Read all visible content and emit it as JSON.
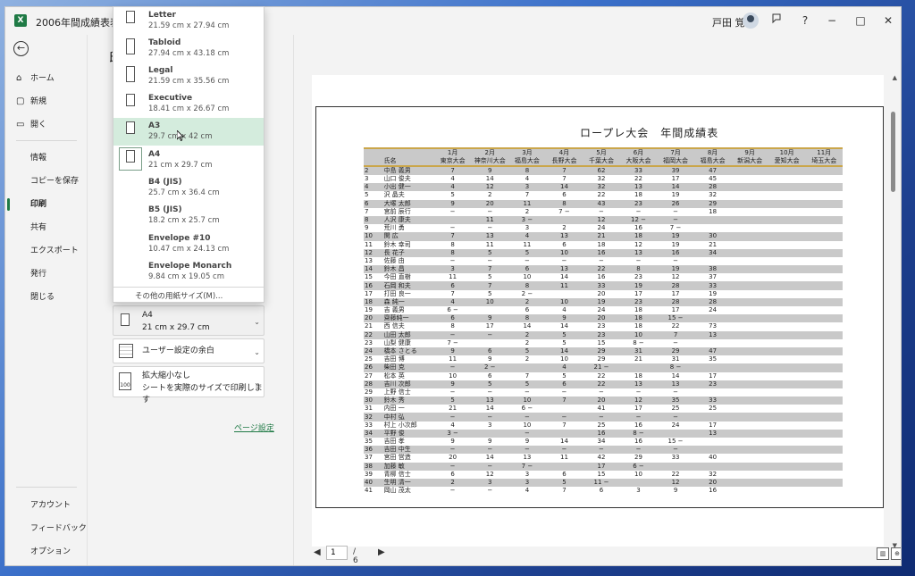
{
  "window": {
    "title": "2006年間成績表表示設定",
    "user_name": "戸田 覚",
    "app_icon": "X"
  },
  "titlebar_buttons": {
    "feedback_icon": "feedback-icon",
    "help": "?",
    "minimize": "−",
    "maximize": "□",
    "close": "✕"
  },
  "sidebar": {
    "back_icon": "←",
    "items": [
      {
        "label": "ホーム",
        "icon": "⌂"
      },
      {
        "label": "新規",
        "icon": "▢"
      },
      {
        "label": "開く",
        "icon": "▭"
      },
      {
        "label": "情報"
      },
      {
        "label": "コピーを保存"
      },
      {
        "label": "印刷"
      },
      {
        "label": "共有"
      },
      {
        "label": "エクスポート"
      },
      {
        "label": "発行"
      },
      {
        "label": "閉じる"
      },
      {
        "label": "アカウント"
      },
      {
        "label": "フィードバック"
      },
      {
        "label": "オプション"
      }
    ]
  },
  "panel": {
    "heading_initial": "印",
    "paper_size_value": "A4",
    "paper_size_dims": "21 cm x 29.7 cm",
    "margins_label": "ユーザー設定の余白",
    "scaling_line1": "拡大縮小なし",
    "scaling_line2": "シートを実際のサイズで印刷します",
    "page_setup_link": "ページ設定"
  },
  "paper_dropdown": {
    "items": [
      {
        "name": "Letter",
        "dims": "21.59 cm x 27.94 cm"
      },
      {
        "name": "Tabloid",
        "dims": "27.94 cm x 43.18 cm"
      },
      {
        "name": "Legal",
        "dims": "21.59 cm x 35.56 cm"
      },
      {
        "name": "Executive",
        "dims": "18.41 cm x 26.67 cm"
      },
      {
        "name": "A3",
        "dims": "29.7 cm x 42 cm"
      },
      {
        "name": "A4",
        "dims": "21 cm x 29.7 cm"
      },
      {
        "name": "B4 (JIS)",
        "dims": "25.7 cm x 36.4 cm"
      },
      {
        "name": "B5 (JIS)",
        "dims": "18.2 cm x 25.7 cm"
      },
      {
        "name": "Envelope #10",
        "dims": "10.47 cm x 24.13 cm"
      },
      {
        "name": "Envelope Monarch",
        "dims": "9.84 cm x 19.05 cm"
      }
    ],
    "more_label": "その他の用紙サイズ(M)..."
  },
  "preview": {
    "sheet_title": "ロープレ大会　年間成績表",
    "header_months": [
      "",
      "",
      "1月",
      "2月",
      "3月",
      "4月",
      "5月",
      "6月",
      "7月",
      "8月",
      "9月",
      "10月",
      "11月"
    ],
    "header_venues": [
      "",
      "氏名",
      "東京大会",
      "神奈川大会",
      "福島大会",
      "長野大会",
      "千葉大会",
      "大阪大会",
      "福岡大会",
      "福島大会",
      "新潟大会",
      "愛知大会",
      "埼玉大会"
    ],
    "rows": [
      [
        "2",
        "中島 義男",
        "7",
        "9",
        "8",
        "7",
        "62",
        "33",
        "39",
        "47",
        "",
        "",
        ""
      ],
      [
        "3",
        "山口 俊夫",
        "4",
        "14",
        "4",
        "7",
        "32",
        "22",
        "17",
        "45",
        "",
        "",
        ""
      ],
      [
        "4",
        "小出 健一",
        "4",
        "12",
        "3",
        "14",
        "32",
        "13",
        "14",
        "28",
        "",
        "",
        ""
      ],
      [
        "5",
        "沢 晶夫",
        "5",
        "2",
        "7",
        "6",
        "22",
        "18",
        "19",
        "32",
        "",
        "",
        ""
      ],
      [
        "6",
        "大塚 太郎",
        "9",
        "20",
        "11",
        "8",
        "43",
        "23",
        "26",
        "29",
        "",
        "",
        ""
      ],
      [
        "7",
        "宮前 辰行",
        "−",
        "−",
        "2",
        "7 −",
        "−",
        "−",
        "−",
        "18",
        "",
        "",
        ""
      ],
      [
        "8",
        "人沢 康夫",
        "",
        "11",
        "3 −",
        "",
        "12",
        "12 −",
        "−",
        "",
        "",
        "",
        ""
      ],
      [
        "9",
        "荒川 勇",
        "−",
        "−",
        "3",
        "2",
        "24",
        "16",
        "7 −",
        "",
        "",
        "",
        ""
      ],
      [
        "10",
        "関 広",
        "7",
        "13",
        "4",
        "13",
        "21",
        "18",
        "19",
        "30",
        "",
        "",
        ""
      ],
      [
        "11",
        "鈴木 幸司",
        "8",
        "11",
        "11",
        "6",
        "18",
        "12",
        "19",
        "21",
        "",
        "",
        ""
      ],
      [
        "12",
        "長 花子",
        "8",
        "5",
        "5",
        "10",
        "16",
        "13",
        "16",
        "34",
        "",
        "",
        ""
      ],
      [
        "13",
        "佐藤 由",
        "−",
        "−",
        "−",
        "−",
        "−",
        "−",
        "−",
        "",
        "",
        "",
        ""
      ],
      [
        "14",
        "鈴木 昌",
        "3",
        "7",
        "6",
        "13",
        "22",
        "8",
        "19",
        "38",
        "",
        "",
        ""
      ],
      [
        "15",
        "今田 直樹",
        "11",
        "5",
        "10",
        "14",
        "16",
        "23",
        "12",
        "37",
        "",
        "",
        ""
      ],
      [
        "16",
        "石岡 和夫",
        "6",
        "7",
        "8",
        "11",
        "33",
        "19",
        "28",
        "33",
        "",
        "",
        ""
      ],
      [
        "17",
        "打田 良一",
        "7",
        "5",
        "2 −",
        "",
        "20",
        "17",
        "17",
        "19",
        "",
        "",
        ""
      ],
      [
        "18",
        "森 純一",
        "4",
        "10",
        "2",
        "10",
        "19",
        "23",
        "28",
        "28",
        "",
        "",
        ""
      ],
      [
        "19",
        "吉 義男",
        "6 −",
        "",
        "6",
        "4",
        "24",
        "18",
        "17",
        "24",
        "",
        "",
        ""
      ],
      [
        "20",
        "齋藤純一",
        "6",
        "9",
        "8",
        "9",
        "20",
        "18",
        "15 −",
        "",
        "",
        "",
        ""
      ],
      [
        "21",
        "西 信夫",
        "8",
        "17",
        "14",
        "14",
        "23",
        "18",
        "22",
        "73",
        "",
        "",
        ""
      ],
      [
        "22",
        "山田 太郎",
        "−",
        "−",
        "2",
        "5",
        "23",
        "10",
        "7",
        "13",
        "",
        "",
        ""
      ],
      [
        "23",
        "山梨 健康",
        "7 −",
        "",
        "2",
        "5",
        "15",
        "8 −",
        "−",
        "",
        "",
        "",
        ""
      ],
      [
        "24",
        "橋本 さとる",
        "9",
        "6",
        "5",
        "14",
        "29",
        "31",
        "29",
        "47",
        "",
        "",
        ""
      ],
      [
        "25",
        "吉田 博",
        "11",
        "9",
        "2",
        "10",
        "29",
        "21",
        "31",
        "35",
        "",
        "",
        ""
      ],
      [
        "26",
        "柴田 克",
        "−",
        "2 −",
        "",
        "4",
        "21 −",
        "",
        "8 −",
        "",
        "",
        "",
        ""
      ],
      [
        "27",
        "松本 英",
        "10",
        "6",
        "7",
        "5",
        "22",
        "18",
        "14",
        "17",
        "",
        "",
        ""
      ],
      [
        "28",
        "吉川 次郎",
        "9",
        "5",
        "5",
        "6",
        "22",
        "13",
        "13",
        "23",
        "",
        "",
        ""
      ],
      [
        "29",
        "上野 信士",
        "−",
        "−",
        "−",
        "−",
        "−",
        "−",
        "−",
        "",
        "",
        "",
        ""
      ],
      [
        "30",
        "鈴木 秀",
        "5",
        "13",
        "10",
        "7",
        "20",
        "12",
        "35",
        "33",
        "",
        "",
        ""
      ],
      [
        "31",
        "内田 一",
        "21",
        "14",
        "6 −",
        "",
        "41",
        "17",
        "25",
        "25",
        "",
        "",
        ""
      ],
      [
        "32",
        "中村 弘",
        "−",
        "−",
        "−",
        "−",
        "−",
        "−",
        "−",
        "",
        "",
        "",
        ""
      ],
      [
        "33",
        "村上 小次郎",
        "4",
        "3",
        "10",
        "7",
        "25",
        "16",
        "24",
        "17",
        "",
        "",
        ""
      ],
      [
        "34",
        "平野 俊",
        "3 −",
        "",
        "−",
        "",
        "16",
        "8 −",
        "",
        "13",
        "",
        "",
        ""
      ],
      [
        "35",
        "吉田 孝",
        "9",
        "9",
        "9",
        "14",
        "34",
        "16",
        "15 −",
        "",
        "",
        "",
        ""
      ],
      [
        "36",
        "吉田 中生",
        "−",
        "−",
        "−",
        "−",
        "−",
        "−",
        "−",
        "",
        "",
        "",
        ""
      ],
      [
        "37",
        "宮田 営造",
        "20",
        "14",
        "13",
        "11",
        "42",
        "29",
        "33",
        "40",
        "",
        "",
        ""
      ],
      [
        "38",
        "加藤 敏",
        "−",
        "−",
        "7 −",
        "",
        "17",
        "6 −",
        "",
        "",
        "",
        "",
        ""
      ],
      [
        "39",
        "青柳 信士",
        "6",
        "12",
        "3",
        "6",
        "15",
        "10",
        "22",
        "32",
        "",
        "",
        ""
      ],
      [
        "40",
        "生明 清一",
        "2",
        "3",
        "3",
        "5",
        "11 −",
        "",
        "12",
        "20",
        "",
        "",
        ""
      ],
      [
        "41",
        "岡山 茂太",
        "−",
        "−",
        "4",
        "7",
        "6",
        "3",
        "9",
        "16",
        "",
        "",
        ""
      ]
    ],
    "pager_current": "1",
    "pager_total": "/ 6"
  },
  "colors": {
    "accent": "#1f7a45",
    "hover": "#d4ecdd",
    "row_shade": "#c9c9c9",
    "header_rule": "#caa64a"
  }
}
